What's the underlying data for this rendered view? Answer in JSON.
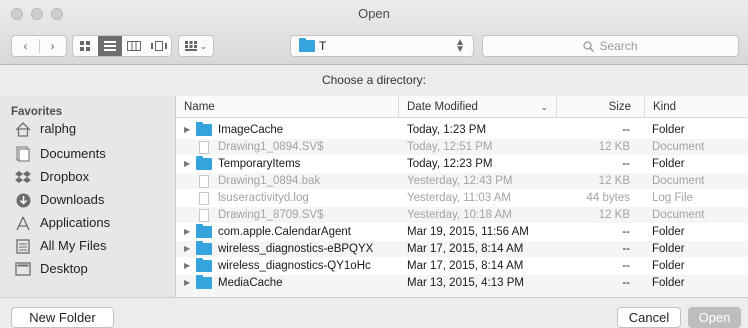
{
  "window": {
    "title": "Open"
  },
  "toolbar": {
    "location": "T",
    "search_placeholder": "Search",
    "location_chevron": "⌃⌄"
  },
  "prompt": "Choose a directory:",
  "sidebar": {
    "heading": "Favorites",
    "items": [
      {
        "label": "ralphg",
        "icon": "home-icon"
      },
      {
        "label": "Documents",
        "icon": "documents-icon"
      },
      {
        "label": "Dropbox",
        "icon": "dropbox-icon"
      },
      {
        "label": "Downloads",
        "icon": "downloads-icon"
      },
      {
        "label": "Applications",
        "icon": "applications-icon"
      },
      {
        "label": "All My Files",
        "icon": "all-my-files-icon"
      },
      {
        "label": "Desktop",
        "icon": "desktop-icon"
      }
    ]
  },
  "columns": {
    "name": "Name",
    "date": "Date Modified",
    "size": "Size",
    "kind": "Kind"
  },
  "files": [
    {
      "name": "ImageCache",
      "date": "Today, 1:23 PM",
      "size": "--",
      "kind": "Folder",
      "type": "folder",
      "enabled": true
    },
    {
      "name": "Drawing1_0894.SV$",
      "date": "Today, 12:51 PM",
      "size": "12 KB",
      "kind": "Document",
      "type": "doc",
      "enabled": false
    },
    {
      "name": "TemporaryItems",
      "date": "Today, 12:23 PM",
      "size": "--",
      "kind": "Folder",
      "type": "folder",
      "enabled": true
    },
    {
      "name": "Drawing1_0894.bak",
      "date": "Yesterday, 12:43 PM",
      "size": "12 KB",
      "kind": "Document",
      "type": "doc",
      "enabled": false
    },
    {
      "name": "lsuseractivityd.log",
      "date": "Yesterday, 11:03 AM",
      "size": "44 bytes",
      "kind": "Log File",
      "type": "doc",
      "enabled": false
    },
    {
      "name": "Drawing1_8709.SV$",
      "date": "Yesterday, 10:18 AM",
      "size": "12 KB",
      "kind": "Document",
      "type": "doc",
      "enabled": false
    },
    {
      "name": "com.apple.CalendarAgent",
      "date": "Mar 19, 2015, 11:56 AM",
      "size": "--",
      "kind": "Folder",
      "type": "folder",
      "enabled": true
    },
    {
      "name": "wireless_diagnostics-eBPQYX",
      "date": "Mar 17, 2015, 8:14 AM",
      "size": "--",
      "kind": "Folder",
      "type": "folder",
      "enabled": true
    },
    {
      "name": "wireless_diagnostics-QY1oHc",
      "date": "Mar 17, 2015, 8:14 AM",
      "size": "--",
      "kind": "Folder",
      "type": "folder",
      "enabled": true
    },
    {
      "name": "MediaCache",
      "date": "Mar 13, 2015, 4:13 PM",
      "size": "--",
      "kind": "Folder",
      "type": "folder",
      "enabled": true
    }
  ],
  "buttons": {
    "new_folder": "New Folder",
    "cancel": "Cancel",
    "open": "Open"
  }
}
